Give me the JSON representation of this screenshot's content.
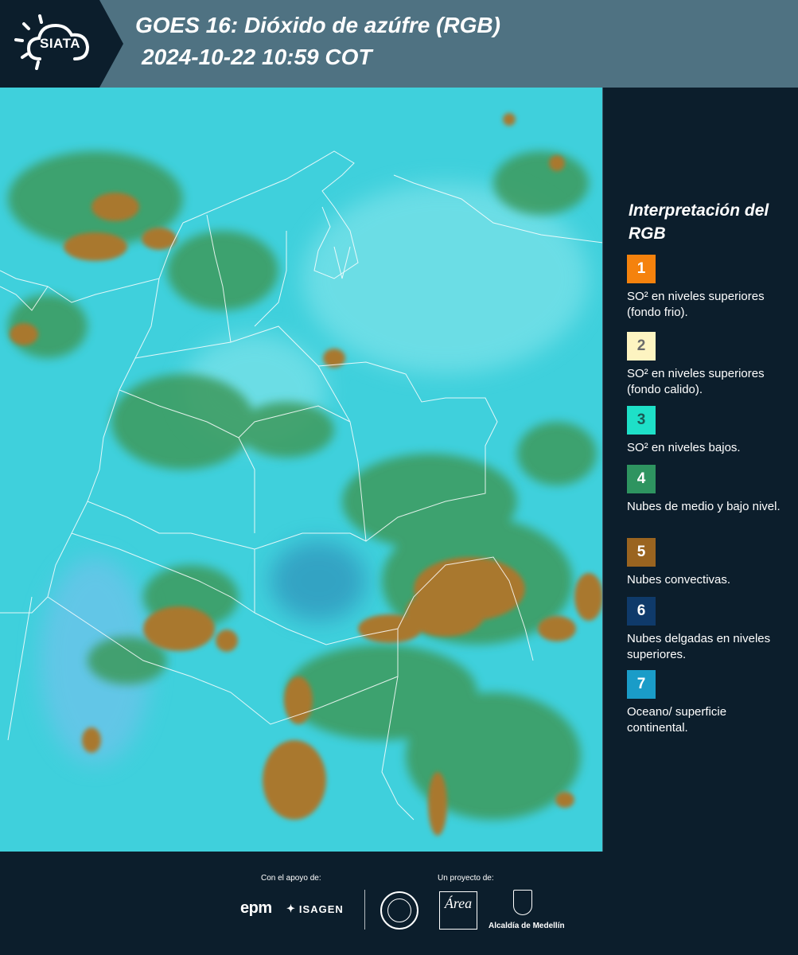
{
  "header": {
    "logo_text": "SIATA",
    "title_line1": "GOES 16: Dióxido de azúfre (RGB)",
    "title_line2": "2024-10-22 10:59 COT"
  },
  "map": {
    "base_color": "#3fd0dc",
    "convective_color": "#a9782e",
    "low_cloud_color": "#3c9a5c",
    "boundary_color": "#ffffff"
  },
  "legend": {
    "title": "Interpretación del RGB",
    "items": [
      {
        "number": "1",
        "label": "SO² en niveles superiores (fondo frio).",
        "color": "#f5820d",
        "text_color": "#ffffff"
      },
      {
        "number": "2",
        "label": "SO² en niveles superiores (fondo calido).",
        "color": "#fdf4c1",
        "text_color": "#6b6b6b"
      },
      {
        "number": "3",
        "label": "SO² en niveles bajos.",
        "color": "#1ee0c8",
        "text_color": "#1a5a55"
      },
      {
        "number": "4",
        "label": "Nubes de medio y bajo nivel.",
        "color": "#2e9460",
        "text_color": "#ffffff"
      },
      {
        "number": "5",
        "label": "Nubes convectivas.",
        "color": "#9a6420",
        "text_color": "#ffffff"
      },
      {
        "number": "6",
        "label": "Nubes delgadas en niveles superiores.",
        "color": "#0f3a6a",
        "text_color": "#ffffff"
      },
      {
        "number": "7",
        "label": "Oceano/ superficie continental.",
        "color": "#1a9cc8",
        "text_color": "#ffffff"
      }
    ]
  },
  "footer": {
    "support_label": "Con el apoyo de:",
    "project_label": "Un proyecto de:",
    "sponsor_epm": "epm",
    "sponsor_isagen": "ISAGEN",
    "area_logo": "Área",
    "alcaldia": "Alcaldía de Medellín"
  }
}
